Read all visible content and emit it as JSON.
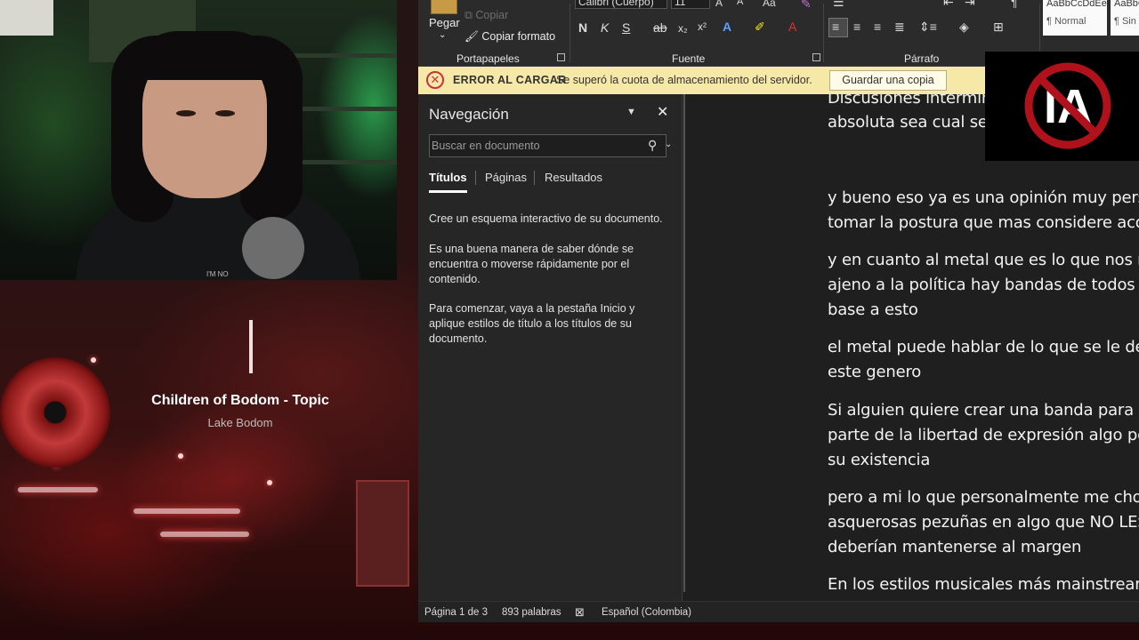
{
  "now_playing": {
    "title": "Children of Bodom - Topic",
    "subtitle": "Lake Bodom"
  },
  "webcam": {
    "shirt_text": "I'M NO"
  },
  "ribbon": {
    "paste_label": "Pegar",
    "copy_label": "Copiar",
    "copy_format_label": "Copiar formato",
    "font_name": "Calibri (Cuerpo)",
    "font_size": "11",
    "groups": {
      "clipboard": "Portapapeles",
      "font": "Fuente",
      "paragraph": "Párrafo"
    },
    "styles": [
      {
        "preview": "AaBbCcDdEe",
        "name": "¶ Normal"
      },
      {
        "preview": "AaBbC",
        "name": "¶ Sin"
      }
    ]
  },
  "message_bar": {
    "title": "ERROR AL CARGAR",
    "text": "Se superó la cuota de almacenamiento del servidor.",
    "button": "Guardar una copia"
  },
  "navigation": {
    "title": "Navegación",
    "search_placeholder": "Buscar en documento",
    "tabs": [
      "Títulos",
      "Páginas",
      "Resultados"
    ],
    "paragraphs": [
      "Cree un esquema interactivo de su documento.",
      "Es una buena manera de saber dónde se encuentra o moverse rápidamente por el contenido.",
      "Para comenzar, vaya a la pestaña Inicio y aplique estilos de título a los títulos de su documento."
    ]
  },
  "document": {
    "lines": [
      "Discusiones intermin",
      "absoluta sea cual sea",
      "y bueno eso ya es una opinión muy perso",
      "tomar la postura que mas considere acor",
      "y en cuanto al metal que es lo que nos re",
      "ajeno a la política hay bandas de todos lo",
      "base a esto",
      "el metal puede hablar de lo que se le de l",
      "este genero",
      "Si alguien quiere crear una banda para ad",
      "parte de la libertad de expresión algo por",
      "su existencia",
      "pero a mi lo que personalmente me choc",
      "asquerosas pezuñas en algo que NO LES P",
      "deberían mantenerse al margen",
      "En los estilos musicales más mainstream"
    ]
  },
  "status_bar": {
    "page": "Página 1 de 3",
    "words": "893 palabras",
    "language": "Español (Colombia)"
  },
  "logo": {
    "text": "IA"
  },
  "colors": {
    "message_bar_bg": "#f6e9a8",
    "error_red": "#c8323a",
    "logo_red": "#b0121b",
    "word_dark": "#212121"
  }
}
